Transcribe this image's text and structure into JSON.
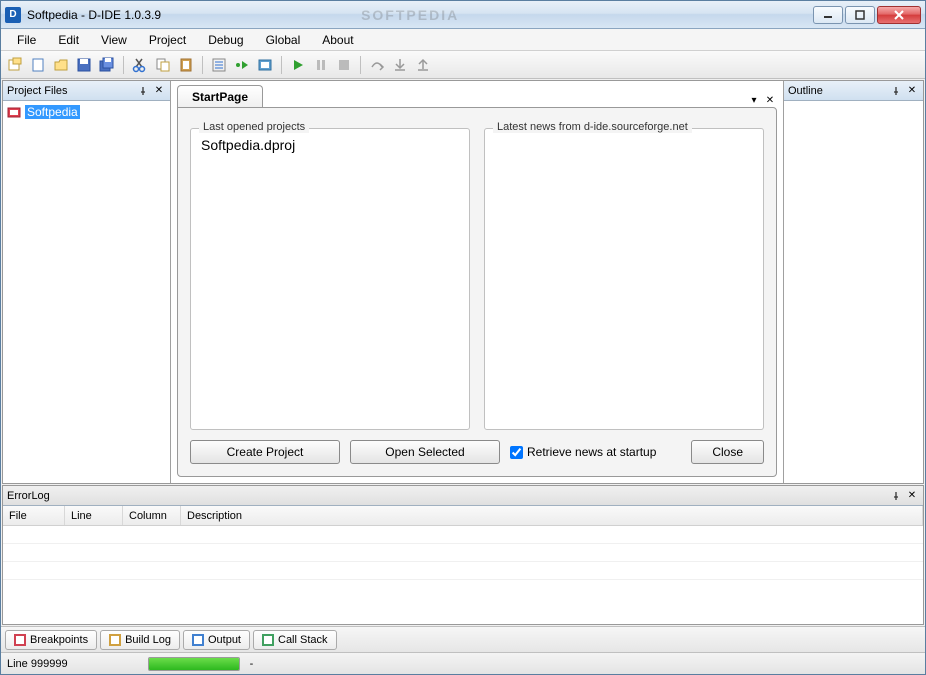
{
  "window": {
    "title": "Softpedia - D-IDE 1.0.3.9",
    "watermark": "SOFTPEDIA",
    "app_badge": "D"
  },
  "menu": {
    "items": [
      "File",
      "Edit",
      "View",
      "Project",
      "Debug",
      "Global",
      "About"
    ]
  },
  "panels": {
    "project_files": {
      "title": "Project Files",
      "items": [
        {
          "label": "Softpedia"
        }
      ]
    },
    "outline": {
      "title": "Outline"
    },
    "errorlog": {
      "title": "ErrorLog",
      "columns": [
        "File",
        "Line",
        "Column",
        "Description"
      ]
    }
  },
  "tabs": {
    "start": "StartPage"
  },
  "startpage": {
    "last_opened_label": "Last opened projects",
    "last_opened_items": [
      "Softpedia.dproj"
    ],
    "news_label": "Latest news from d-ide.sourceforge.net",
    "create_project": "Create Project",
    "open_selected": "Open Selected",
    "retrieve_news": "Retrieve news at startup",
    "retrieve_news_checked": true,
    "close": "Close"
  },
  "bottom_tabs": [
    "Breakpoints",
    "Build Log",
    "Output",
    "Call Stack"
  ],
  "status": {
    "line_label": "Line 999999",
    "progress_pct": 100,
    "extra": "-"
  },
  "column_widths": {
    "file": 62,
    "line": 58,
    "column": 58,
    "description": 600
  }
}
